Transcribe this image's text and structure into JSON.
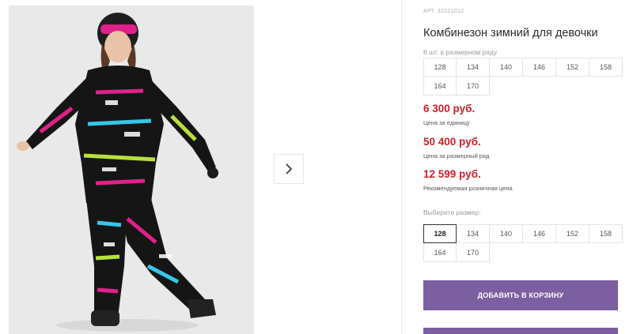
{
  "product": {
    "article": "АРТ. 32321012",
    "title": "Комбинезон зимний для девочки",
    "pack_label": "8 шт. в размерном ряду",
    "pack_sizes": [
      "128",
      "134",
      "140",
      "146",
      "152",
      "158",
      "164",
      "170"
    ]
  },
  "prices": {
    "unit_price": "6 300 руб.",
    "unit_note": "Цена за единицу",
    "pack_price": "50 400 руб.",
    "pack_note": "Цена за размерный ряд",
    "retail_price": "12 599 руб.",
    "retail_note": "Рекомендуемая розничная цена"
  },
  "size_select": {
    "label": "Выберите размер:",
    "sizes": [
      "128",
      "134",
      "140",
      "146",
      "152",
      "158",
      "164",
      "170"
    ],
    "selected": "128"
  },
  "actions": {
    "add_to_cart": "ДОБАВИТЬ В КОРЗИНУ"
  },
  "colors": {
    "accent": "#7b5fa0",
    "price": "#d0212d"
  },
  "icons": {
    "next": "chevron-right-icon"
  }
}
